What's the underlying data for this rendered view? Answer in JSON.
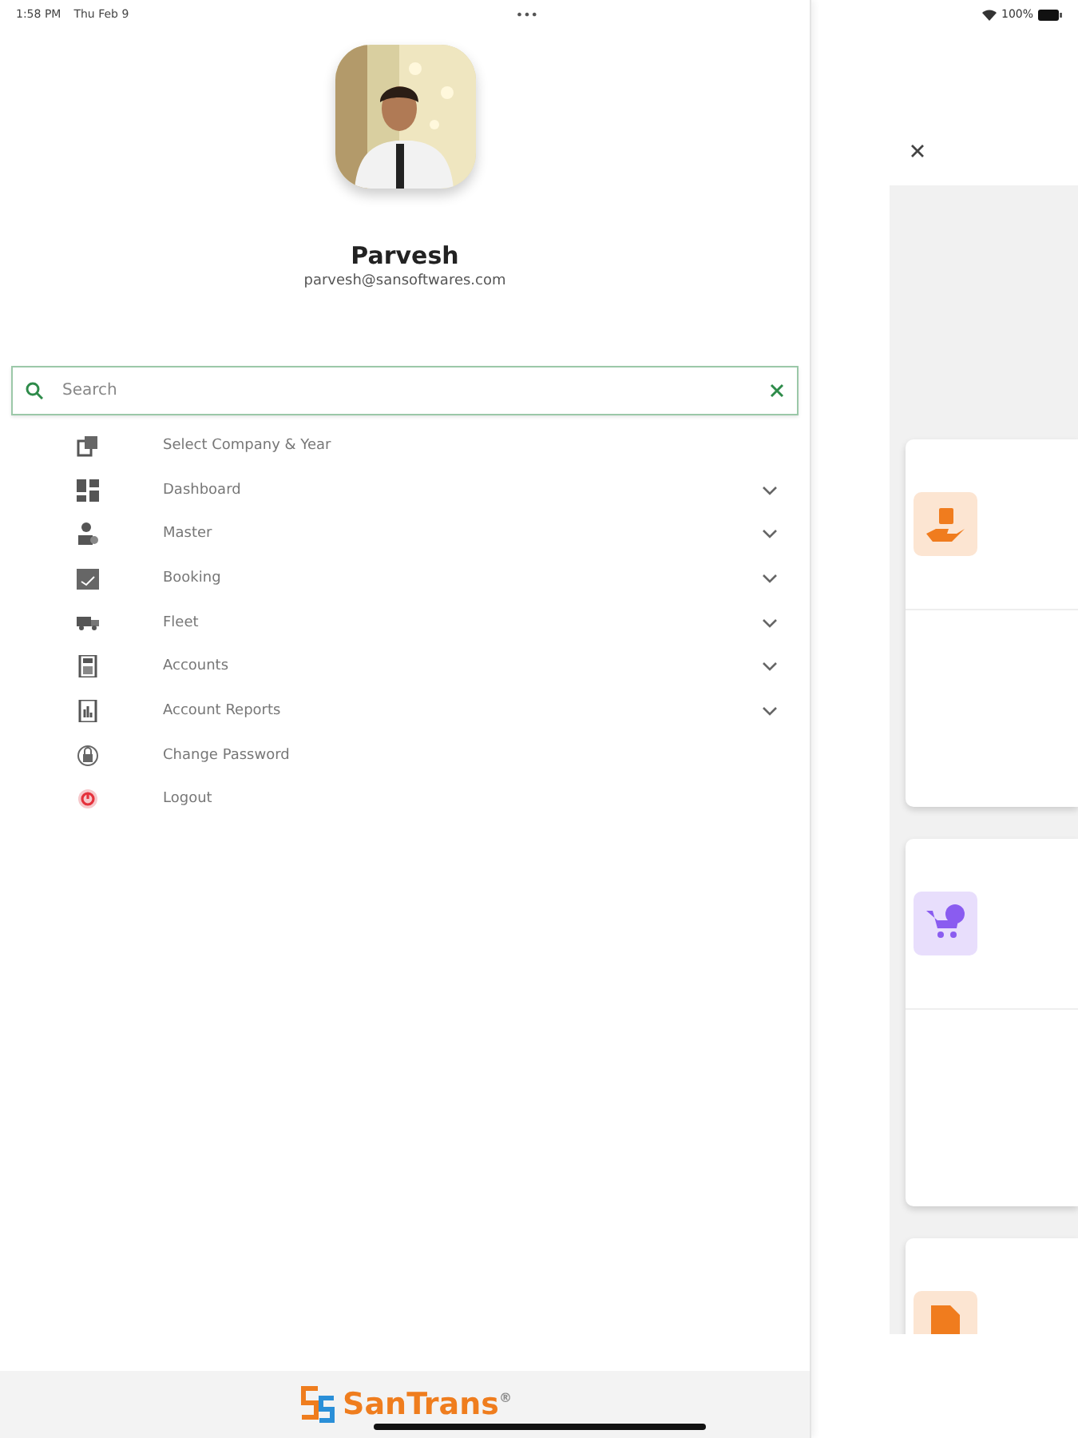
{
  "status_bar": {
    "time": "1:58 PM",
    "date": "Thu Feb 9",
    "dots": "•••",
    "battery": "100%"
  },
  "profile": {
    "name": "Parvesh",
    "email": "parvesh@sansoftwares.com"
  },
  "search": {
    "placeholder": "Search"
  },
  "menu": [
    {
      "label": "Select Company & Year",
      "expandable": false
    },
    {
      "label": "Dashboard",
      "expandable": true
    },
    {
      "label": "Master",
      "expandable": true
    },
    {
      "label": "Booking",
      "expandable": true
    },
    {
      "label": "Fleet",
      "expandable": true
    },
    {
      "label": "Accounts",
      "expandable": true
    },
    {
      "label": "Account Reports",
      "expandable": true
    },
    {
      "label": "Change Password",
      "expandable": false
    },
    {
      "label": "Logout",
      "expandable": false
    }
  ],
  "footer": {
    "logo": "SanTrans$^{®}$"
  },
  "cards": [
    {
      "color": "#f07c1e"
    },
    {
      "color": "#8a5cf0"
    },
    {
      "color": "#f07c1e"
    }
  ]
}
